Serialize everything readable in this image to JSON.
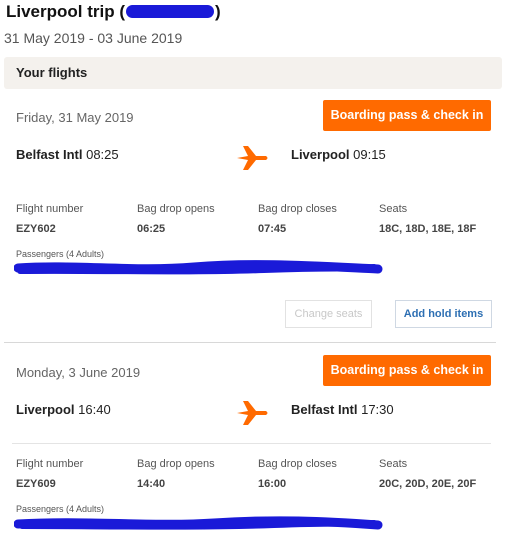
{
  "trip": {
    "title_prefix": "Liverpool trip (",
    "title_suffix": ")",
    "dates": "31 May 2019 - 03 June 2019"
  },
  "flights_header": "Your flights",
  "flights": [
    {
      "date": "Friday, 31 May 2019",
      "board_label": "Boarding pass & check in",
      "from_city": "Belfast Intl",
      "from_time": "08:25",
      "to_city": "Liverpool",
      "to_time": "09:15",
      "flight_number_label": "Flight number",
      "flight_number": "EZY602",
      "bag_open_label": "Bag drop opens",
      "bag_open": "06:25",
      "bag_close_label": "Bag drop closes",
      "bag_close": "07:45",
      "seats_label": "Seats",
      "seats": "18C, 18D, 18E, 18F",
      "passengers": "Passengers (4 Adults)",
      "change_seats_label": "Change seats",
      "hold_items_label": "Add hold items"
    },
    {
      "date": "Monday, 3 June 2019",
      "board_label": "Boarding pass & check in",
      "from_city": "Liverpool",
      "from_time": "16:40",
      "to_city": "Belfast Intl",
      "to_time": "17:30",
      "flight_number_label": "Flight number",
      "flight_number": "EZY609",
      "bag_open_label": "Bag drop opens",
      "bag_open": "14:40",
      "bag_close_label": "Bag drop closes",
      "bag_close": "16:00",
      "seats_label": "Seats",
      "seats": "20C, 20D, 20E, 20F",
      "passengers": "Passengers (4 Adults)"
    }
  ],
  "colors": {
    "accent": "#ff6a00",
    "link": "#2d6fb3",
    "redaction": "#1a1ad8"
  },
  "icons": [
    "plane-icon"
  ]
}
